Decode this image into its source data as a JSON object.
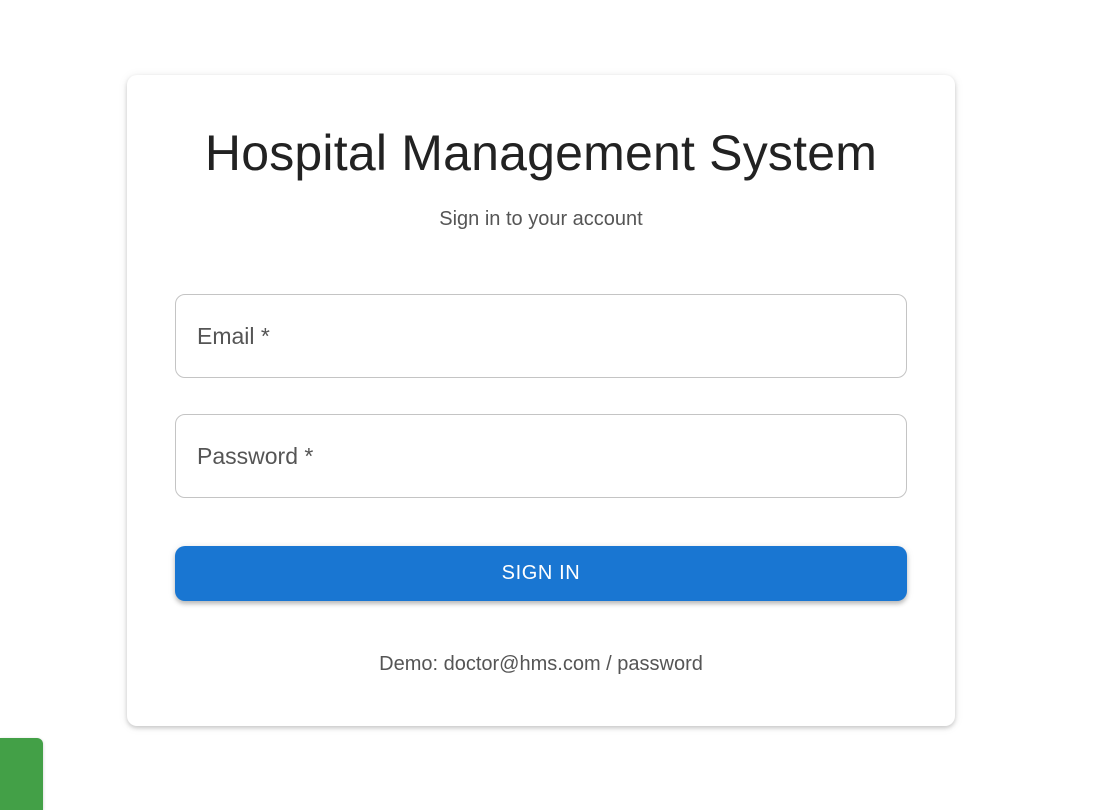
{
  "login": {
    "title": "Hospital Management System",
    "subtitle": "Sign in to your account",
    "email_label": "Email *",
    "password_label": "Password *",
    "sign_in_label": "SIGN IN",
    "demo_hint": "Demo: doctor@hms.com / password"
  },
  "colors": {
    "primary_button": "#1976d2",
    "floating_tab": "#43a047"
  }
}
